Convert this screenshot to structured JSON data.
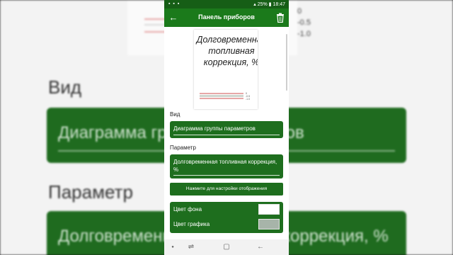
{
  "status_bar": {
    "notification_icons": "▪ ▪ ▪",
    "battery_percent": "25%",
    "time": "18:47"
  },
  "app_bar": {
    "back_icon": "arrow-left-icon",
    "title": "Панель приборов",
    "delete_icon": "trash-icon"
  },
  "preview": {
    "title": "Долговременная топливная коррекция, %",
    "tick_labels": [
      "0",
      "-0.5",
      "-1.0"
    ]
  },
  "form": {
    "view_label": "Вид",
    "view_value": "Диаграмма группы параметров",
    "parameter_label": "Параметр",
    "parameter_value": "Долговременная топливная коррекция, %",
    "display_settings_button": "Нажмите для настройки отображения",
    "bg_color_label": "Цвет фона",
    "bg_color_value": "#ffffff",
    "graph_color_label": "Цвет графика",
    "graph_color_value": "#a7b4a9"
  },
  "background_copy": {
    "tick_labels": [
      "0",
      "-0.5",
      "-1.0"
    ],
    "view_label": "Вид",
    "view_value": "Диаграмма группы параметров",
    "parameter_label": "Параметр",
    "parameter_value": "Долговременная топливная коррекция, %"
  },
  "colors": {
    "primary": "#1b7a1b",
    "status": "#165e16",
    "field": "#1e6e1e"
  }
}
